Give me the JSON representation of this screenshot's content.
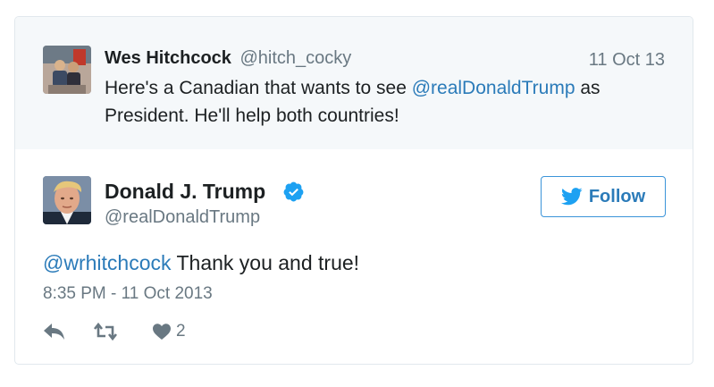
{
  "parent_tweet": {
    "author_name": "Wes Hitchcock",
    "author_handle": "@hitch_cocky",
    "date": "11 Oct 13",
    "text_before": "Here's a Canadian that wants to see ",
    "mention": "@realDonaldTrump",
    "text_after": " as President. He'll help both countries!"
  },
  "tweet": {
    "author_name": "Donald J. Trump",
    "author_handle": "@realDonaldTrump",
    "verified": true,
    "follow_label": "Follow",
    "reply_mention": "@wrhitchcock",
    "text": " Thank you and true!",
    "timestamp": "8:35 PM - 11 Oct 2013",
    "like_count": "2"
  },
  "icons": {
    "reply": "reply-icon",
    "retweet": "retweet-icon",
    "like": "heart-icon",
    "verified": "verified-badge-icon",
    "follow": "twitter-bird-icon"
  },
  "colors": {
    "link": "#2b7bb9",
    "muted": "#697882",
    "text": "#1c2022",
    "verified": "#1da1f2",
    "parent_bg": "#f5f8fa",
    "border": "#e1e8ed"
  }
}
